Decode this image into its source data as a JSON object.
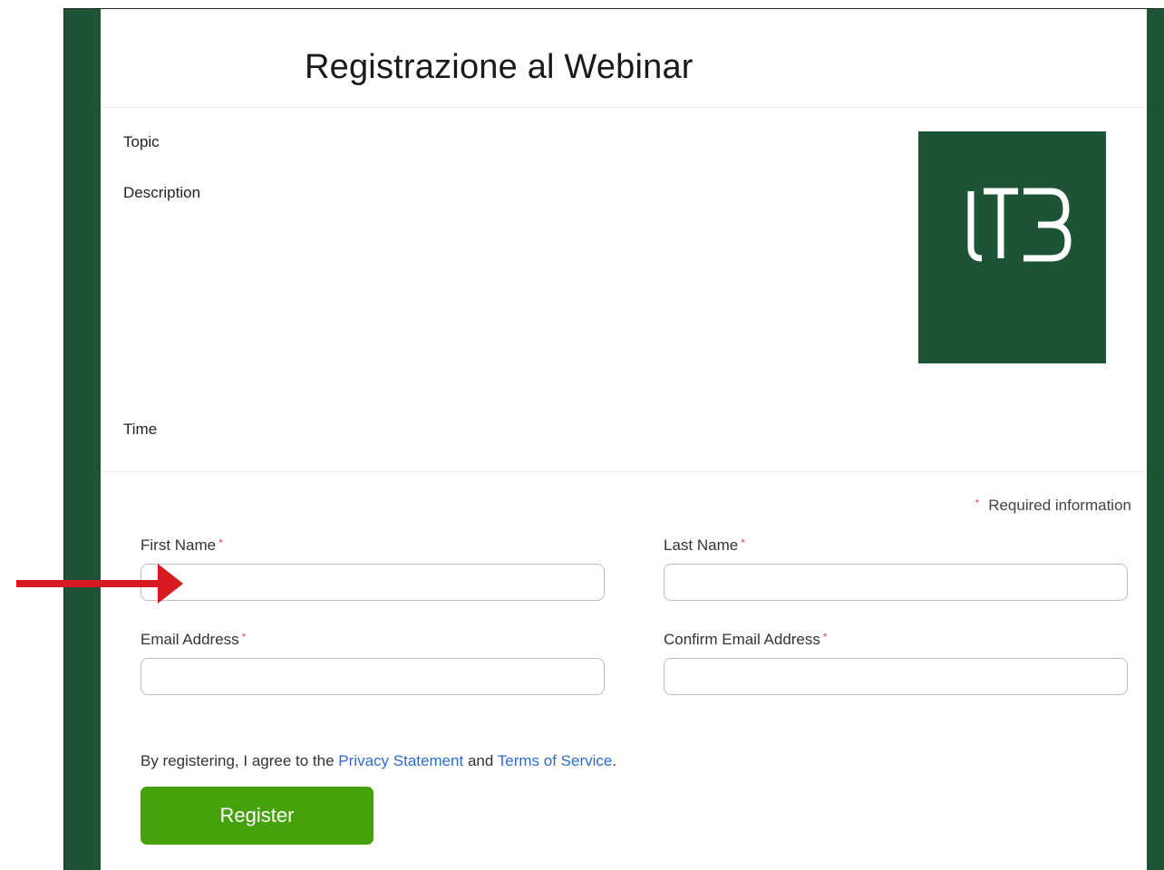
{
  "header": {
    "title": "Registrazione al Webinar"
  },
  "details": {
    "topic_label": "Topic",
    "description_label": "Description",
    "time_label": "Time",
    "logo_text": "LT3"
  },
  "form": {
    "required_note": "Required information",
    "required_marker": "*",
    "first_name_label": "First Name",
    "first_name_value": "",
    "last_name_label": "Last Name",
    "last_name_value": "",
    "email_label": "Email Address",
    "email_value": "",
    "confirm_email_label": "Confirm Email Address",
    "confirm_email_value": "",
    "agree_prefix": "By registering, I agree to the ",
    "privacy_link": "Privacy Statement",
    "agree_and": " and ",
    "terms_link": "Terms of Service",
    "agree_suffix": ".",
    "register_label": "Register"
  },
  "annotation": {
    "arrow_icon": "red-arrow-right-icon",
    "arrow_color": "#d71920"
  },
  "colors": {
    "brand_green": "#1d5435",
    "button_green": "#46a10a",
    "link_blue": "#2d6bd1",
    "required_red": "#e8474c"
  }
}
